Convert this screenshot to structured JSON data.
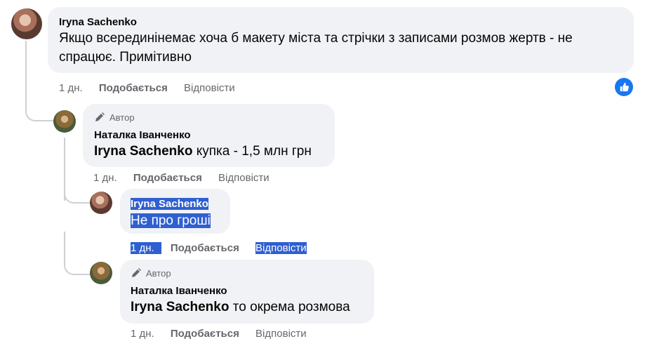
{
  "comments": [
    {
      "author": "Iryna Sachenko",
      "text": "Якщо всерединінемає хоча б макету міста та стрічки з записами розмов жертв - не спрацює. Примітивно",
      "time": "1 дн.",
      "like": "Подобається",
      "reply": "Відповісти",
      "reaction_icon": "thumbs-up-icon"
    },
    {
      "badge": "Автор",
      "author": "Наталка Іванченко",
      "mention": "Iryna Sachenko",
      "text": " купка - 1,5 млн грн",
      "time": "1 дн.",
      "like": "Подобається",
      "reply": "Відповісти"
    },
    {
      "author": "Iryna Sachenko",
      "text": "Не про гроші",
      "time": "1 дн.",
      "like": "Подобається",
      "reply": "Відповісти"
    },
    {
      "badge": "Автор",
      "author": "Наталка Іванченко",
      "mention": "Iryna Sachenko",
      "text": " то окрема розмова",
      "time": "1 дн.",
      "like": "Подобається",
      "reply": "Відповісти"
    }
  ],
  "colors": {
    "bubble": "#f0f2f5",
    "secondary_text": "#65676b",
    "selection": "#2f5fd0",
    "like_blue": "#1877f2"
  }
}
